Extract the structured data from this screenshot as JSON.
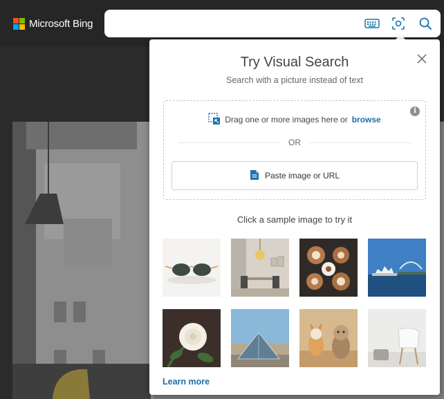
{
  "brand": {
    "name": "Microsoft Bing",
    "logo_colors": [
      "#f25022",
      "#7fba00",
      "#00a4ef",
      "#ffb900"
    ]
  },
  "search": {
    "value": "",
    "icons": [
      "keyboard-icon",
      "visual-search-icon",
      "search-icon"
    ]
  },
  "visual_search": {
    "title": "Try Visual Search",
    "subtitle": "Search with a picture instead of text",
    "drag_text": "Drag one or more images here or",
    "browse_label": "browse",
    "or_label": "OR",
    "paste_label": "Paste image or URL",
    "sample_caption": "Click a sample image to try it",
    "samples": [
      {
        "subject": "sunglasses"
      },
      {
        "subject": "dining-room"
      },
      {
        "subject": "latte-art"
      },
      {
        "subject": "sydney-opera-house"
      },
      {
        "subject": "white-rose"
      },
      {
        "subject": "louvre-pyramid"
      },
      {
        "subject": "dogs"
      },
      {
        "subject": "white-chair"
      }
    ],
    "learn_more_label": "Learn more"
  },
  "colors": {
    "accent": "#1e6ea7",
    "topbar": "#262626",
    "icon_blue": "#1a73ad"
  }
}
